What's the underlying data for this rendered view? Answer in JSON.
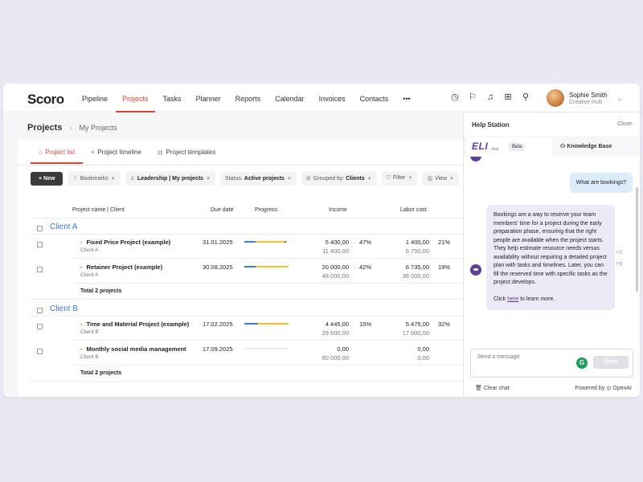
{
  "app": {
    "logo": "Scoro"
  },
  "nav": {
    "items": [
      {
        "label": "Pipeline",
        "active": false
      },
      {
        "label": "Projects",
        "active": true
      },
      {
        "label": "Tasks",
        "active": false
      },
      {
        "label": "Planner",
        "active": false
      },
      {
        "label": "Reports",
        "active": false
      },
      {
        "label": "Calendar",
        "active": false
      },
      {
        "label": "Invoices",
        "active": false
      },
      {
        "label": "Contacts",
        "active": false
      }
    ],
    "more": "•••",
    "icons": [
      "timer-icon",
      "bookmark-icon",
      "bell-icon",
      "add-icon",
      "search-icon"
    ],
    "user": {
      "name": "Sophie Smith",
      "company": "Creative Hub"
    }
  },
  "page": {
    "title": "Projects",
    "breadcrumb": "My Projects",
    "tabs": [
      "Project list",
      "Project timeline",
      "Project templates"
    ],
    "toolbar": {
      "new": "+ New",
      "bookmarks": "Bookmarks",
      "view_prefix": "Leadership | My projects",
      "status_label": "Status:",
      "status_value": "Active projects",
      "grouped_label": "Grouped by:",
      "grouped_value": "Clients",
      "filter": "Filter",
      "view": "View"
    },
    "columns": {
      "name": "Project name | Client",
      "due": "Due date",
      "progress": "Progress",
      "income": "Income",
      "labor": "Labor cost"
    }
  },
  "groups": [
    {
      "name": "Client A",
      "total": "Total 2 projects",
      "rows": [
        {
          "name": "Fixed Price Project (example)",
          "client": "Client A",
          "due": "31.01.2025",
          "income": "5 400,00",
          "income_sub": "11 400,00",
          "income_pct": "47%",
          "labor": "1 400,00",
          "labor_sub": "6 750,00",
          "labor_pct": "21%",
          "progress": [
            0.25,
            0.65,
            0.05
          ]
        },
        {
          "name": "Retainer Project (example)",
          "client": "Client A",
          "due": "30.08.2025",
          "income": "20 000,00",
          "income_sub": "48 000,00",
          "income_pct": "42%",
          "labor": "6 735,00",
          "labor_sub": "36 000,00",
          "labor_pct": "19%",
          "progress": [
            0.25,
            0.75,
            0
          ]
        }
      ]
    },
    {
      "name": "Client B",
      "total": "Total 2 projects",
      "rows": [
        {
          "name": "Time and Material Project (example)",
          "client": "Client B",
          "due": "17.02.2025",
          "income": "4 445,00",
          "income_sub": "29 600,00",
          "income_pct": "15%",
          "labor": "5 475,00",
          "labor_sub": "17 000,00",
          "labor_pct": "32%",
          "progress": [
            0.3,
            0.7,
            0
          ]
        },
        {
          "name": "Monthly social media management",
          "client": "Client B",
          "due": "17.09.2025",
          "income": "0,00",
          "income_sub": "60 000,00",
          "income_pct": "",
          "labor": "0,00",
          "labor_sub": "0,00",
          "labor_pct": "",
          "progress": [
            0,
            0,
            0
          ]
        }
      ]
    }
  ],
  "colors": {
    "accent": "#d9453b",
    "progress_blue": "#3b7dd8",
    "progress_yellow": "#f2c230",
    "progress_red": "#e04a3f",
    "eli": "#5b3fa6"
  },
  "help": {
    "title": "Help Station",
    "close": "Close",
    "eli_logo": "ELI",
    "eli_sub": "chat",
    "beta": "Beta",
    "kb": "Knowledge Base",
    "user_msg": "What are bookings?",
    "bot_msg": "Bookings are a way to reserve your team members' time for a project during the early preparation phase, ensuring that the right people are available when the project starts. They help estimate resource needs versus availability without requiring a detailed project plan with tasks and timelines. Later, you can fill the reserved time with specific tasks as the project develops.",
    "bot_link_prefix": "Click ",
    "bot_link": "here",
    "bot_link_suffix": " to learn more.",
    "input_placeholder": "Send a message",
    "send": "Send",
    "clear": "Clear chat",
    "powered": "Powered by ◎ OpenAI"
  }
}
